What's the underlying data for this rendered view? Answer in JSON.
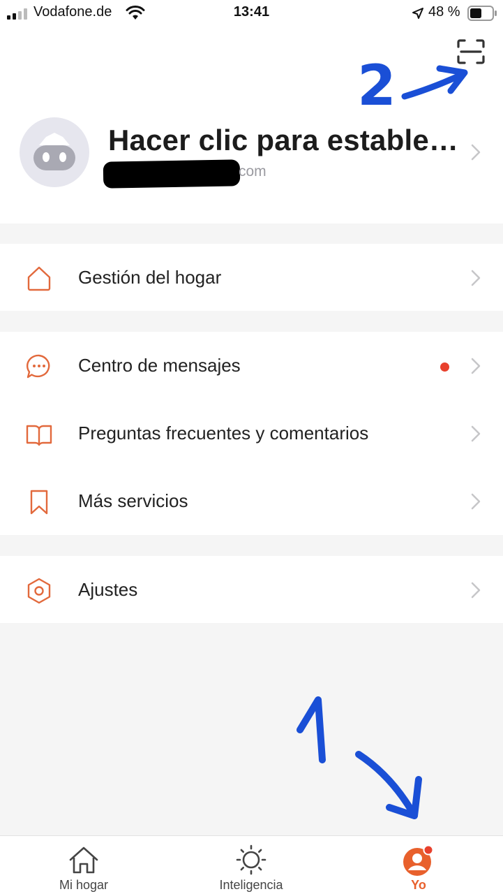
{
  "status_bar": {
    "carrier": "Vodafone.de",
    "time": "13:41",
    "battery": "48 %"
  },
  "profile": {
    "name": "Hacer clic para establec…",
    "email_suffix": "com"
  },
  "menu_groups": [
    {
      "items": [
        {
          "label": "Gestión del hogar",
          "icon": "home-outline-icon"
        }
      ]
    },
    {
      "items": [
        {
          "label": "Centro de mensajes",
          "icon": "message-bubble-icon",
          "unread_dot": true
        },
        {
          "label": "Preguntas frecuentes y comentarios",
          "icon": "open-book-icon"
        },
        {
          "label": "Más servicios",
          "icon": "bookmark-icon"
        }
      ]
    },
    {
      "items": [
        {
          "label": "Ajustes",
          "icon": "hexagon-settings-icon"
        }
      ]
    }
  ],
  "tabs": [
    {
      "label": "Mi hogar",
      "icon": "house-icon",
      "active": false
    },
    {
      "label": "Inteligencia",
      "icon": "sun-icon",
      "active": false
    },
    {
      "label": "Yo",
      "icon": "user-icon",
      "active": true,
      "badge": true
    }
  ],
  "annotations": {
    "first": "1",
    "second": "2"
  },
  "colors": {
    "accent": "#e8602c",
    "icon_orange": "#e2693c",
    "unread_dot": "#e8412d",
    "annotation_blue": "#1a4fd6",
    "background": "#f5f5f5"
  }
}
